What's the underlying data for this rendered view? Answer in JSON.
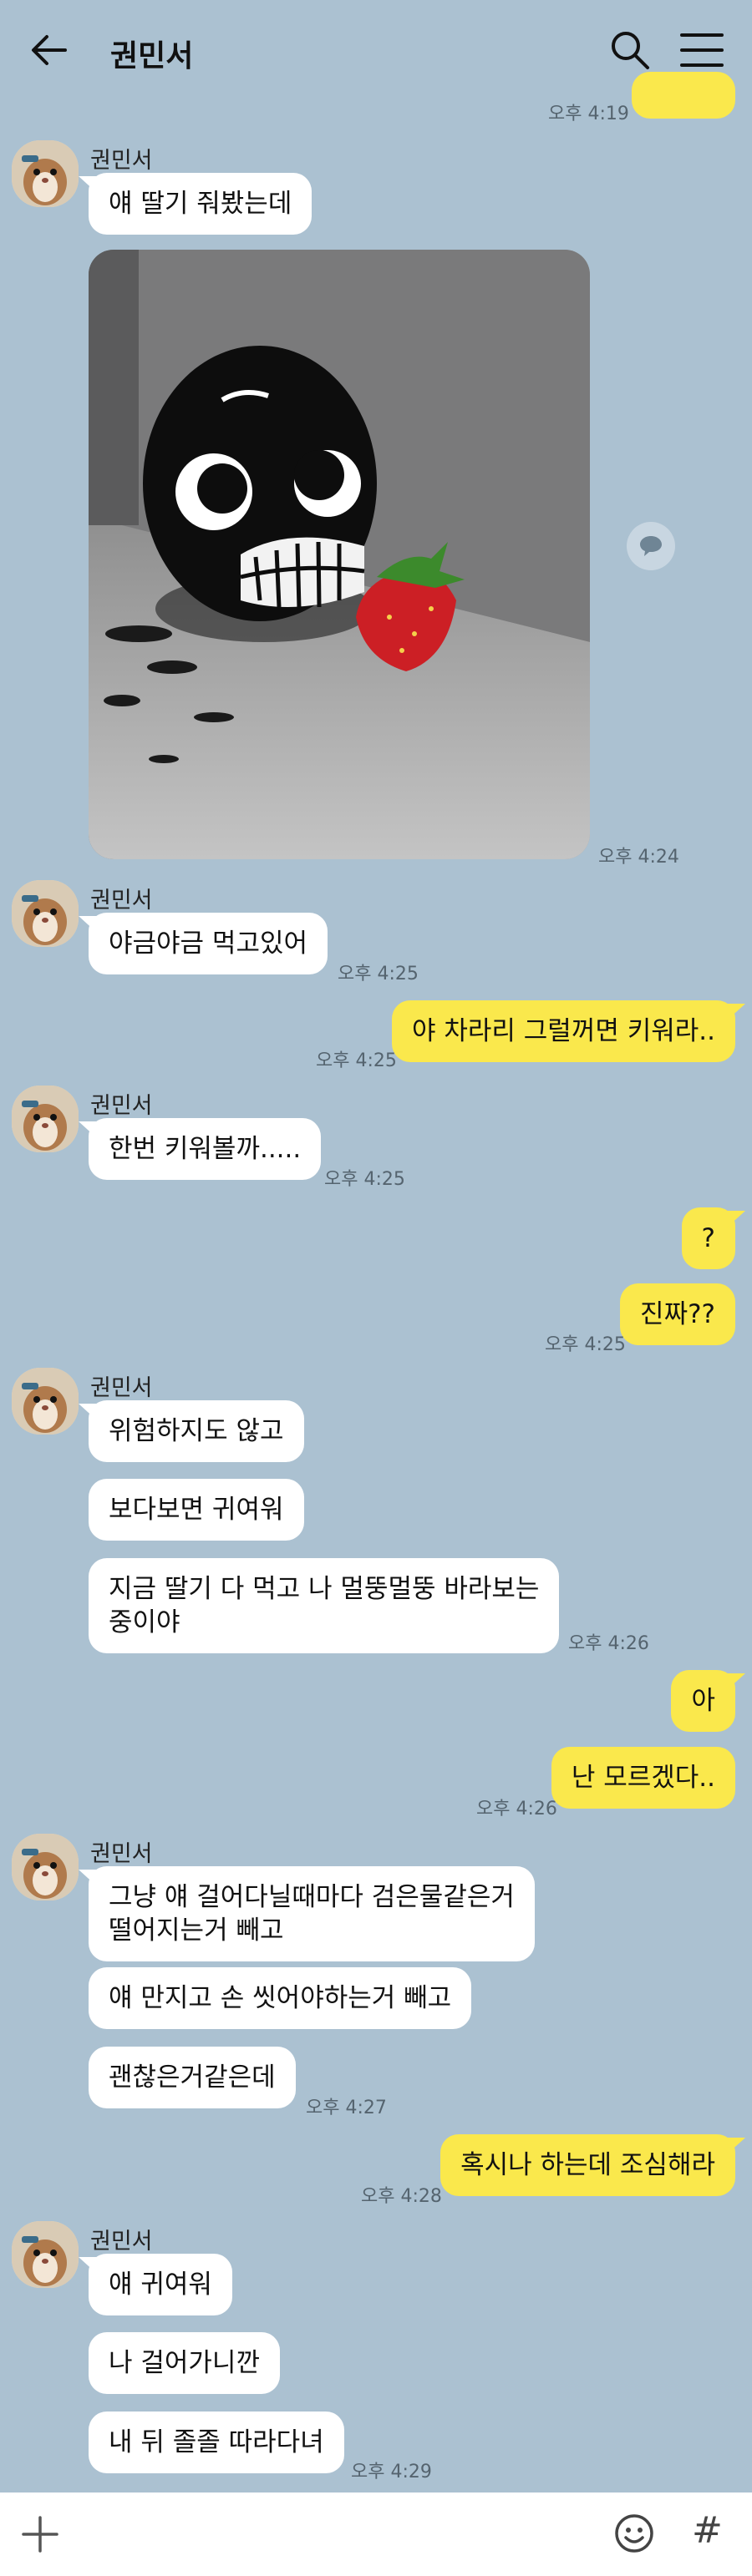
{
  "header": {
    "title": "권민서"
  },
  "icons": {
    "back": "arrow-left-icon",
    "search": "search-icon",
    "menu": "hamburger-menu-icon",
    "share": "share-bubble-icon",
    "plus": "plus-icon",
    "emoji": "emoji-icon",
    "hash": "hash-icon"
  },
  "colors": {
    "background": "#abc1d1",
    "incoming": "#ffffff",
    "outgoing": "#fae84c"
  },
  "messages": {
    "top_time": "오후 4:19",
    "g1": {
      "name": "권민서",
      "m1": "얘 딸기 줘봤는데",
      "time": "오후 4:24"
    },
    "g2": {
      "name": "권민서",
      "m1": "야금야금 먹고있어",
      "time": "오후 4:25"
    },
    "o1": {
      "m1": "야 차라리 그럴꺼면 키워라..",
      "time": "오후 4:25"
    },
    "g3": {
      "name": "권민서",
      "m1": "한번 키워볼까.....",
      "time": "오후 4:25"
    },
    "o2": {
      "m1": "?",
      "m2": "진짜??",
      "time": "오후 4:25"
    },
    "g4": {
      "name": "권민서",
      "m1": "위험하지도 않고",
      "m2": "보다보면 귀여워",
      "m3a": "지금 딸기 다 먹고 나 멀뚱멀뚱 바라보는",
      "m3b": "중이야",
      "time": "오후 4:26"
    },
    "o3": {
      "m1": "아",
      "m2": "난 모르겠다..",
      "time": "오후 4:26"
    },
    "g5": {
      "name": "권민서",
      "m1a": "그냥 얘 걸어다닐때마다 검은물같은거",
      "m1b": "떨어지는거 빼고",
      "m2": "얘 만지고 손 씻어야하는거 빼고",
      "m3": "괜찮은거같은데",
      "time": "오후 4:27"
    },
    "o4": {
      "m1": "혹시나 하는데 조심해라",
      "time": "오후 4:28"
    },
    "g6": {
      "name": "권민서",
      "m1": "얘 귀여워",
      "m2": "나 걸어가니깐",
      "m3": "내 뒤 졸졸 따라다녀",
      "time": "오후 4:29"
    }
  }
}
